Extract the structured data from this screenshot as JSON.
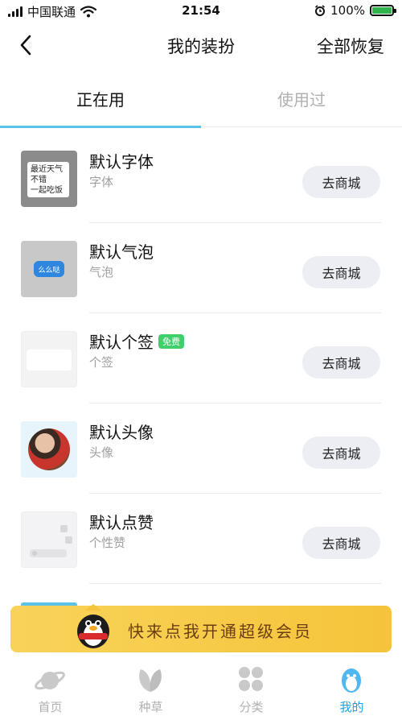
{
  "status_bar": {
    "carrier": "中国联通",
    "time": "21:54",
    "battery_percent": "100%"
  },
  "nav": {
    "title": "我的装扮",
    "action": "全部恢复"
  },
  "tabs": [
    {
      "label": "正在用",
      "active": true
    },
    {
      "label": "使用过",
      "active": false
    }
  ],
  "items": [
    {
      "title": "默认字体",
      "subtitle": "字体",
      "button": "去商城",
      "thumb_text": "最近天气\n不错\n一起吃饭"
    },
    {
      "title": "默认气泡",
      "subtitle": "气泡",
      "button": "去商城",
      "thumb_text": "么么哒"
    },
    {
      "title": "默认个签",
      "subtitle": "个签",
      "button": "去商城",
      "badge": "免费"
    },
    {
      "title": "默认头像",
      "subtitle": "头像",
      "button": "去商城"
    },
    {
      "title": "默认点赞",
      "subtitle": "个性赞",
      "button": "去商城"
    }
  ],
  "banner": {
    "text": "快来点我开通超级会员"
  },
  "bottom_nav": [
    {
      "label": "首页",
      "icon": "planet-icon",
      "active": false
    },
    {
      "label": "种草",
      "icon": "leaf-icon",
      "active": false
    },
    {
      "label": "分类",
      "icon": "grid-icon",
      "active": false
    },
    {
      "label": "我的",
      "icon": "penguin-icon",
      "active": true
    }
  ],
  "colors": {
    "accent": "#5cc3e8",
    "active_nav": "#1aa3e8",
    "button_bg": "#eceef3",
    "banner": "#f6c941",
    "free_badge": "#3fcf6b"
  }
}
